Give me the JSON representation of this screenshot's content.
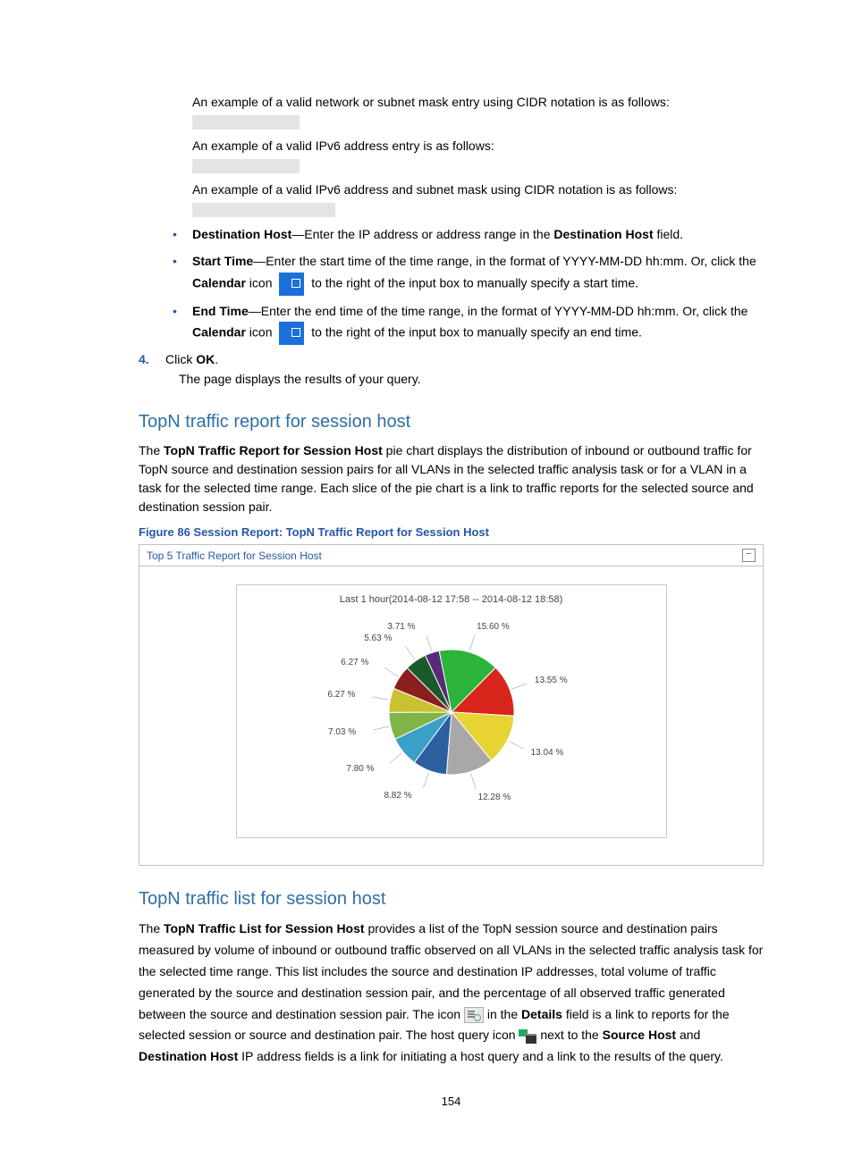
{
  "intro": {
    "p1": "An example of a valid network or subnet mask entry using CIDR notation is as follows:",
    "p2": "An example of a valid IPv6 address entry is as follows:",
    "p3": "An example of a valid IPv6 address and subnet mask using CIDR notation is as follows:"
  },
  "bullets": {
    "dest_label": "Destination Host",
    "dest_rest": "—Enter the IP address or address range in the ",
    "dest_bold2": "Destination Host",
    "dest_tail": " field.",
    "start_label": "Start Time",
    "start_rest": "—Enter the start time of the time range, in the format of YYYY-MM-DD hh:mm. Or, click the ",
    "cal_word": "Calendar",
    "start_tail": " to the right of the input box to manually specify a start time.",
    "icon_word": " icon ",
    "end_label": "End Time",
    "end_rest": "—Enter the end time of the time range, in the format of YYYY-MM-DD hh:mm. Or, click the ",
    "end_tail": " to the right of the input box to manually specify an end time."
  },
  "step4": {
    "num": "4.",
    "text_a": "Click ",
    "text_b": "OK",
    "text_c": ".",
    "followup": "The page displays the results of your query."
  },
  "section1": {
    "heading": "TopN traffic report for session host",
    "p_a": "The ",
    "p_b": "TopN Traffic Report for Session Host",
    "p_c": " pie chart displays the distribution of inbound or outbound traffic for TopN source and destination session pairs for all VLANs in the selected traffic analysis task or for a VLAN in a task for the selected time range. Each slice of the pie chart is a link to traffic reports for the selected source and destination session pair.",
    "fig": "Figure 86 Session Report: TopN Traffic Report for Session Host",
    "panel_title": "Top 5 Traffic Report for Session Host",
    "collapse": "−",
    "chart_title": "Last 1 hour(2014-08-12 17:58 -- 2014-08-12 18:58)"
  },
  "chart_data": {
    "type": "pie",
    "title": "Last 1 hour(2014-08-12 17:58 -- 2014-08-12 18:58)",
    "series": [
      {
        "label": "15.60 %",
        "value": 15.6,
        "color": "#2bb33a"
      },
      {
        "label": "13.55 %",
        "value": 13.55,
        "color": "#d9261c"
      },
      {
        "label": "13.04 %",
        "value": 13.04,
        "color": "#e8d334"
      },
      {
        "label": "12.28 %",
        "value": 12.28,
        "color": "#a8a8a8"
      },
      {
        "label": "8.82 %",
        "value": 8.82,
        "color": "#2b5fa0"
      },
      {
        "label": "7.80 %",
        "value": 7.8,
        "color": "#3aa0c8"
      },
      {
        "label": "7.03 %",
        "value": 7.03,
        "color": "#7fb548"
      },
      {
        "label": "6.27 %",
        "value": 6.27,
        "color": "#c8c130"
      },
      {
        "label": "6.27 %",
        "value": 6.27,
        "color": "#8a1f1f"
      },
      {
        "label": "5.63 %",
        "value": 5.63,
        "color": "#195a2a"
      },
      {
        "label": "3.71 %",
        "value": 3.71,
        "color": "#5a2a7a"
      }
    ]
  },
  "section2": {
    "heading": "TopN traffic list for session host",
    "p_a": "The ",
    "p_b": "TopN Traffic List for Session Host",
    "p_c": " provides a list of the TopN session source and destination pairs measured by volume of inbound or outbound traffic observed on all VLANs in the selected traffic analysis task for the selected time range. This list includes the source and destination IP addresses, total volume of traffic generated by the source and destination session pair, and the percentage of all observed traffic generated between the source and destination session pair. The icon ",
    "p_d": " in the ",
    "p_e": "Details",
    "p_f": " field is a link to reports for the selected session or source and destination pair. The host query icon ",
    "p_g": " next to the ",
    "p_h": "Source Host",
    "p_i": " and ",
    "p_j": "Destination Host",
    "p_k": " IP address fields is a link for initiating a host query and a link to the results of the query."
  },
  "page_number": "154"
}
